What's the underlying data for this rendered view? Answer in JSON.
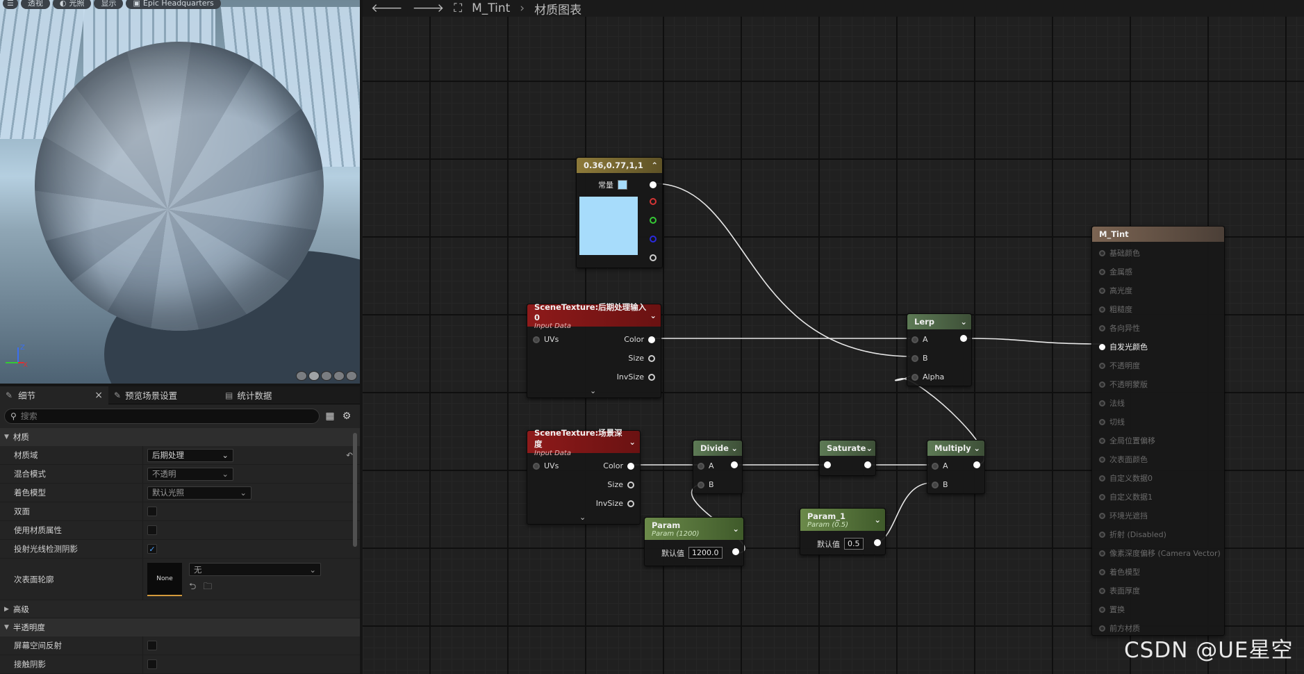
{
  "viewport": {
    "toolbar": [
      "透视",
      "光照",
      "显示",
      "Epic Headquarters"
    ],
    "axis": {
      "z": "Z",
      "x": "X"
    }
  },
  "details": {
    "tabs": [
      {
        "label": "细节",
        "close": "×"
      },
      {
        "label": "预览场景设置"
      },
      {
        "label": "统计数据"
      }
    ],
    "search_placeholder": "搜索",
    "category_material": "材质",
    "props": [
      {
        "label": "材质域",
        "value": "后期处理"
      },
      {
        "label": "混合模式",
        "value": "不透明"
      },
      {
        "label": "着色模型",
        "value": "默认光照"
      },
      {
        "label": "双面",
        "checked": false
      },
      {
        "label": "使用材质属性",
        "checked": false
      },
      {
        "label": "投射光线检测阴影",
        "checked": true
      }
    ],
    "subsurface": {
      "label": "次表面轮廓",
      "thumb": "None",
      "value": "无"
    },
    "category_advanced": "高级",
    "category_translucency": "半透明度",
    "trans_props": [
      {
        "label": "屏幕空间反射"
      },
      {
        "label": "接触阴影"
      }
    ]
  },
  "graph": {
    "breadcrumb": {
      "asset": "M_Tint",
      "graph": "材质图表"
    },
    "nodes": {
      "constant": {
        "title": "0.36,0.77,1,1",
        "pin": "常量",
        "color": "#a7dcfb"
      },
      "scene_tex0": {
        "title": "SceneTexture:后期处理输入0",
        "sub": "Input Data",
        "inputs": [
          "UVs"
        ],
        "outputs": [
          "Color",
          "Size",
          "InvSize"
        ]
      },
      "scene_depth": {
        "title": "SceneTexture:场景深度",
        "sub": "Input Data",
        "inputs": [
          "UVs"
        ],
        "outputs": [
          "Color",
          "Size",
          "InvSize"
        ]
      },
      "divide": {
        "title": "Divide",
        "inputs": [
          "A",
          "B"
        ]
      },
      "saturate": {
        "title": "Saturate"
      },
      "multiply": {
        "title": "Multiply",
        "inputs": [
          "A",
          "B"
        ]
      },
      "lerp": {
        "title": "Lerp",
        "inputs": [
          "A",
          "B",
          "Alpha"
        ]
      },
      "param": {
        "title": "Param",
        "sub": "Param (1200)",
        "label": "默认值",
        "value": "1200.0"
      },
      "param1": {
        "title": "Param_1",
        "sub": "Param (0.5)",
        "label": "默认值",
        "value": "0.5"
      },
      "result": {
        "title": "M_Tint",
        "pins": [
          "基础颜色",
          "金属感",
          "高光度",
          "粗糙度",
          "各向异性",
          "自发光颜色",
          "不透明度",
          "不透明蒙版",
          "法线",
          "切线",
          "全局位置偏移",
          "次表面颜色",
          "自定义数据0",
          "自定义数据1",
          "环境光遮挡",
          "折射 (Disabled)",
          "像素深度偏移 (Camera Vector)",
          "着色模型",
          "表面厚度",
          "置换",
          "前方材质"
        ],
        "active": "自发光颜色"
      }
    }
  },
  "watermark": "CSDN @UE星空"
}
